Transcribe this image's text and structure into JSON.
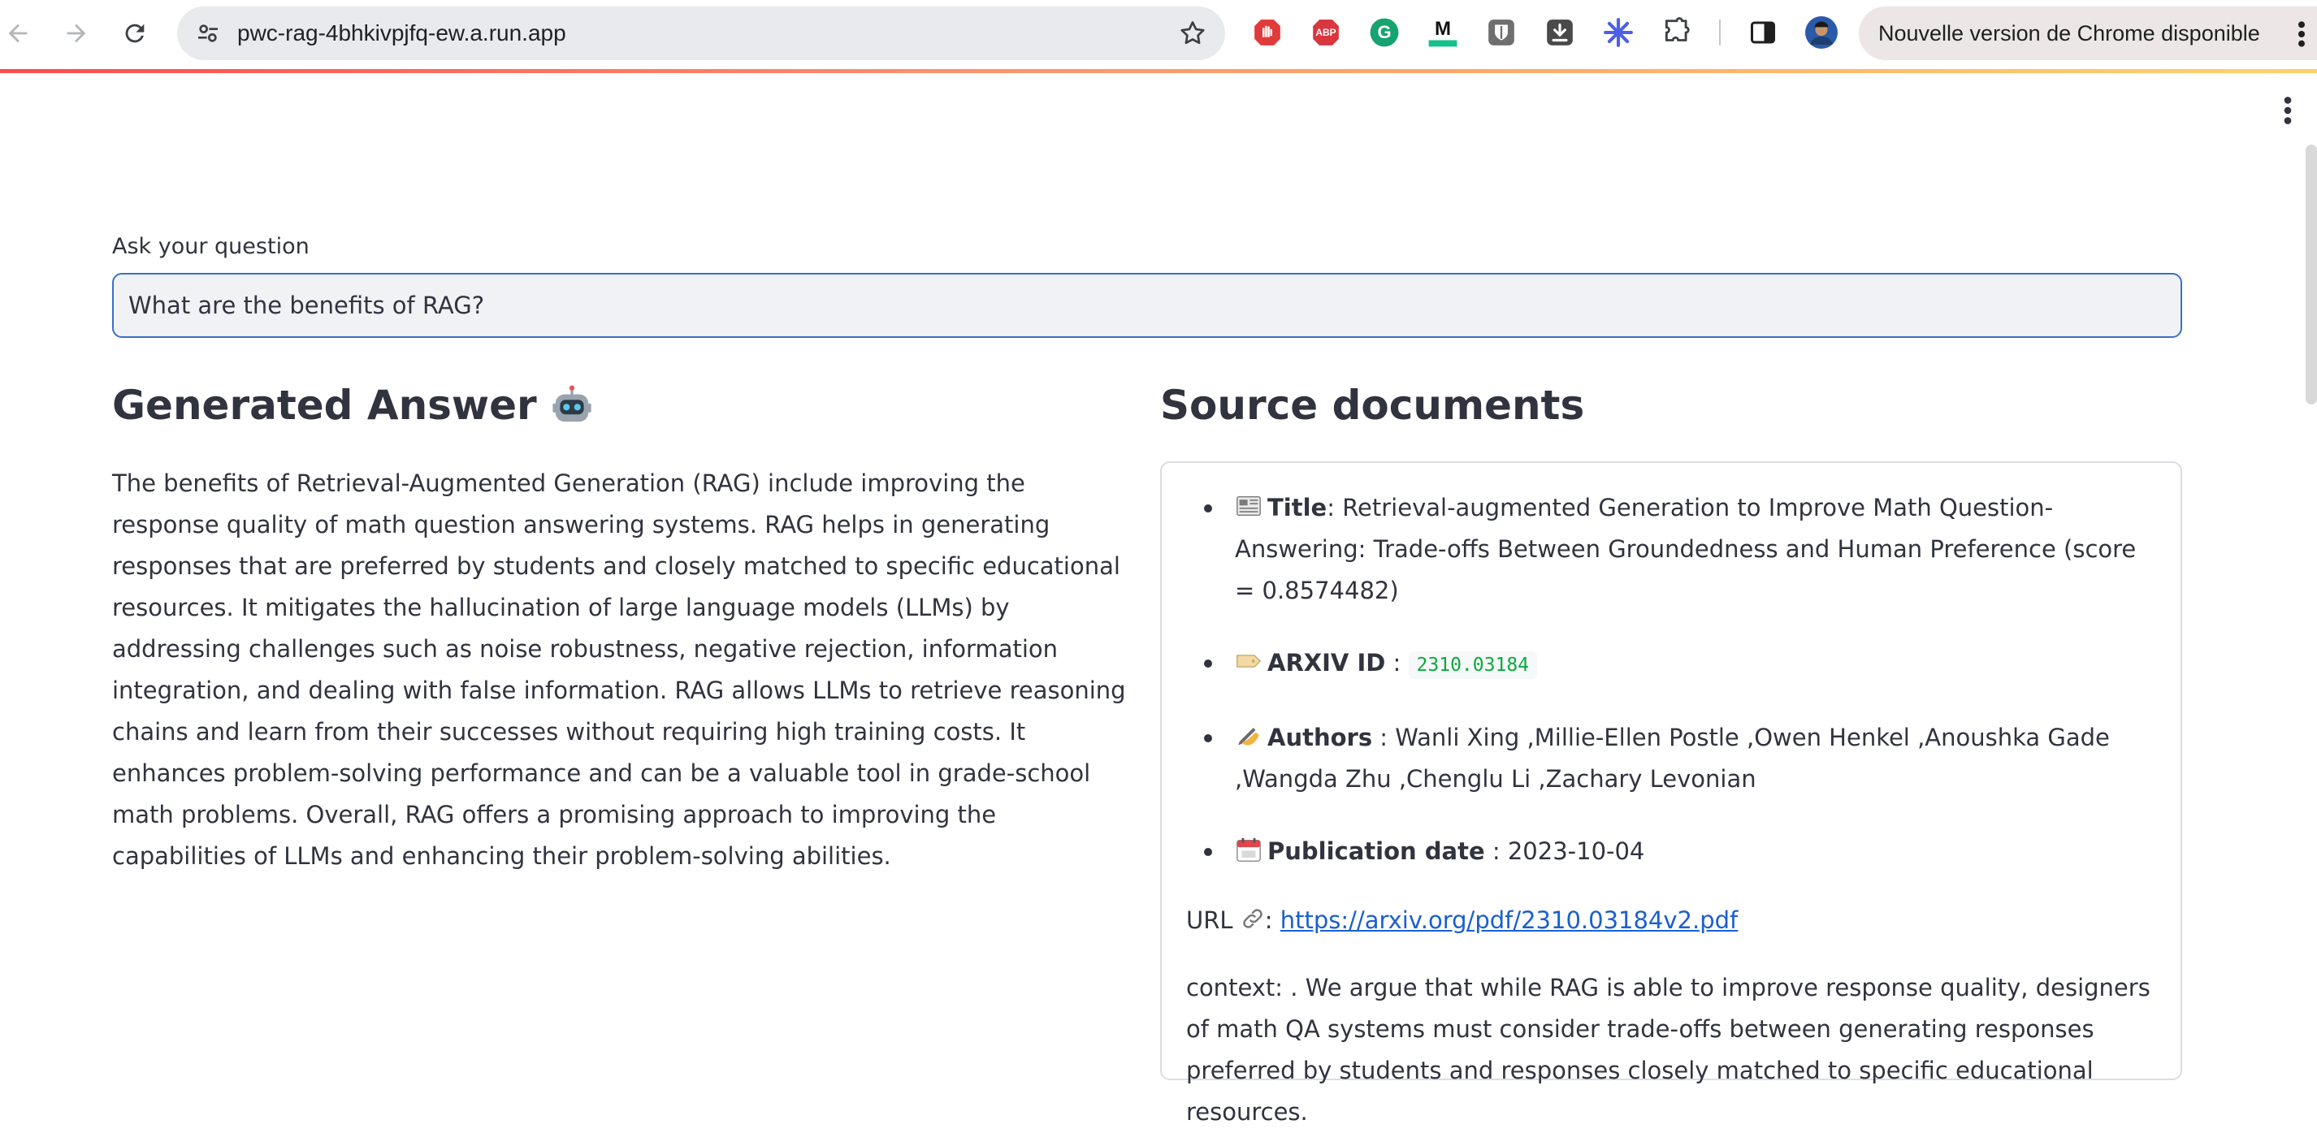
{
  "browser": {
    "url": "pwc-rag-4bhkivpjfq-ew.a.run.app",
    "update_chip": "Nouvelle version de Chrome disponible",
    "extension_icons": [
      "stop-hand-icon",
      "adblock-icon",
      "grammarly-icon",
      "medium-icon",
      "bitwarden-icon",
      "download-icon",
      "asterisk-icon",
      "puzzle-icon"
    ],
    "extension_labels": {
      "adblock": "ABP",
      "grammarly": "G",
      "medium": "M"
    }
  },
  "colors": {
    "accent": "#ff4b4b",
    "input_border": "#3b6fc9",
    "link": "#1a5fd0",
    "code": "#09ab3b"
  },
  "question": {
    "label": "Ask your question",
    "value": "What are the benefits of RAG?"
  },
  "answer": {
    "title": "Generated Answer",
    "text": "The benefits of Retrieval-Augmented Generation (RAG) include improving the response quality of math question answering systems. RAG helps in generating responses that are preferred by students and closely matched to specific educational resources. It mitigates the hallucination of large language models (LLMs) by addressing challenges such as noise robustness, negative rejection, information integration, and dealing with false information. RAG allows LLMs to retrieve reasoning chains and learn from their successes without requiring high training costs. It enhances problem-solving performance and can be a valuable tool in grade-school math problems. Overall, RAG offers a promising approach to improving the capabilities of LLMs and enhancing their problem-solving abilities."
  },
  "sources": {
    "title": "Source documents",
    "doc": {
      "title_label": "Title",
      "title_value": ": Retrieval-augmented Generation to Improve Math Question-Answering: Trade-offs Between Groundedness and Human Preference (score = 0.8574482)",
      "arxiv_label": "ARXIV ID",
      "arxiv_sep": " : ",
      "arxiv_value": "2310.03184",
      "authors_label": "Authors",
      "authors_value": " : Wanli Xing ,Millie-Ellen Postle ,Owen Henkel ,Anoushka Gade ,Wangda Zhu ,Chenglu Li ,Zachary Levonian",
      "date_label": "Publication date",
      "date_value": " : 2023-10-04",
      "url_label": "URL",
      "url_sep": ": ",
      "url_value": "https://arxiv.org/pdf/2310.03184v2.pdf",
      "context": "context: . We argue that while RAG is able to improve response quality, designers of math QA systems must consider trade-offs between generating responses preferred by students and responses closely matched to specific educational resources."
    }
  }
}
